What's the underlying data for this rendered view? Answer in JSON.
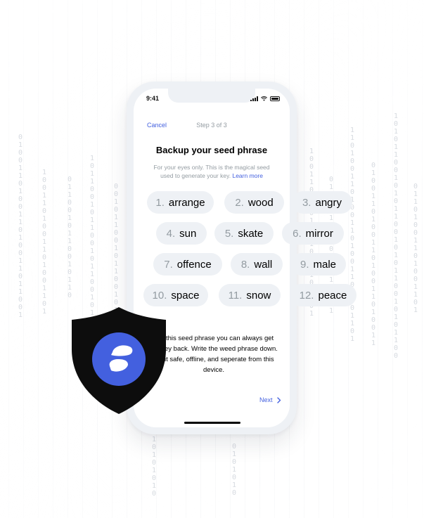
{
  "colors": {
    "accent": "#4360df",
    "muted": "#939ba1",
    "pill_bg": "#eef1f5",
    "shield": "#0d0d0d"
  },
  "status_bar": {
    "time": "9:41",
    "icons": [
      "signal-icon",
      "wifi-icon",
      "battery-icon"
    ]
  },
  "header": {
    "cancel_label": "Cancel",
    "step_label": "Step 3 of 3"
  },
  "main": {
    "title": "Backup your seed phrase",
    "subtitle": "For your eyes only. This is the magical seed used to generate your key.",
    "learn_more_label": "Learn more",
    "words": [
      {
        "num": "1.",
        "word": "arrange"
      },
      {
        "num": "2.",
        "word": "wood"
      },
      {
        "num": "3.",
        "word": "angry"
      },
      {
        "num": "4.",
        "word": "sun"
      },
      {
        "num": "5.",
        "word": "skate"
      },
      {
        "num": "6.",
        "word": "mirror"
      },
      {
        "num": "7.",
        "word": "offence"
      },
      {
        "num": "8.",
        "word": "wall"
      },
      {
        "num": "9.",
        "word": "male"
      },
      {
        "num": "10.",
        "word": "space"
      },
      {
        "num": "11.",
        "word": "snow"
      },
      {
        "num": "12.",
        "word": "peace"
      }
    ],
    "info_lines": [
      "this seed phrase you can always get",
      "ey back. Write the weed phrase down.",
      "it safe, offline, and seperate from this",
      "device."
    ]
  },
  "footer": {
    "next_label": "Next",
    "next_icon": "chevron-right-icon"
  },
  "overlay": {
    "shield_icon": "shield-icon",
    "logo_icon": "status-logo-icon"
  }
}
